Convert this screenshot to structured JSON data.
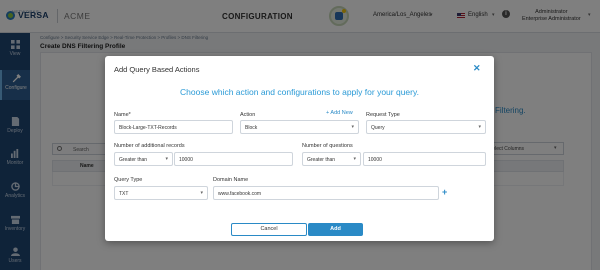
{
  "header": {
    "brand": "VERSA",
    "brand_sub": "NETWORKS",
    "tenant": "ACME",
    "title": "CONFIGURATION",
    "timezone": "America/Los_Angeles",
    "language": "English",
    "user_line1": "Administrator",
    "user_line2": "Enterprise Administrator"
  },
  "sidebar": {
    "items": [
      {
        "label": "View",
        "icon": "grid-icon"
      },
      {
        "label": "Configure",
        "icon": "wrench-icon"
      },
      {
        "label": "Deploy",
        "icon": "document-icon"
      },
      {
        "label": "Monitor",
        "icon": "bar-chart-icon"
      },
      {
        "label": "Analytics",
        "icon": "analytics-icon"
      },
      {
        "label": "Inventory",
        "icon": "inventory-icon"
      },
      {
        "label": "Users",
        "icon": "users-icon"
      }
    ]
  },
  "page": {
    "breadcrumb": "Configure > Security Service Edge > Real-Time Protection > Profiles > DNS Filtering",
    "title": "Create DNS Filtering Profile",
    "filtering_label": "Filtering.",
    "search_placeholder": "Search",
    "select_columns": "Select Columns",
    "table_col_name": "Name"
  },
  "modal": {
    "title": "Add Query Based Actions",
    "subtitle": "Choose which action and configurations to apply for your query.",
    "name_label": "Name*",
    "name_value": "Block-Large-TXT-Records",
    "action_label": "Action",
    "action_value": "Block",
    "add_new": "+ Add New",
    "request_type_label": "Request Type",
    "request_type_value": "Query",
    "additional_records_label": "Number of additional records",
    "additional_records_op": "Greater than",
    "additional_records_value": "10000",
    "questions_label": "Number of questions",
    "questions_op": "Greater than",
    "questions_value": "10000",
    "query_type_label": "Query Type",
    "query_type_value": "TXT",
    "domain_name_label": "Domain Name",
    "domain_name_value": "www.facebook.com",
    "cancel_label": "Cancel",
    "add_label": "Add"
  },
  "colors": {
    "accent": "#2a8ac6",
    "nav_bg": "#1e4673"
  }
}
